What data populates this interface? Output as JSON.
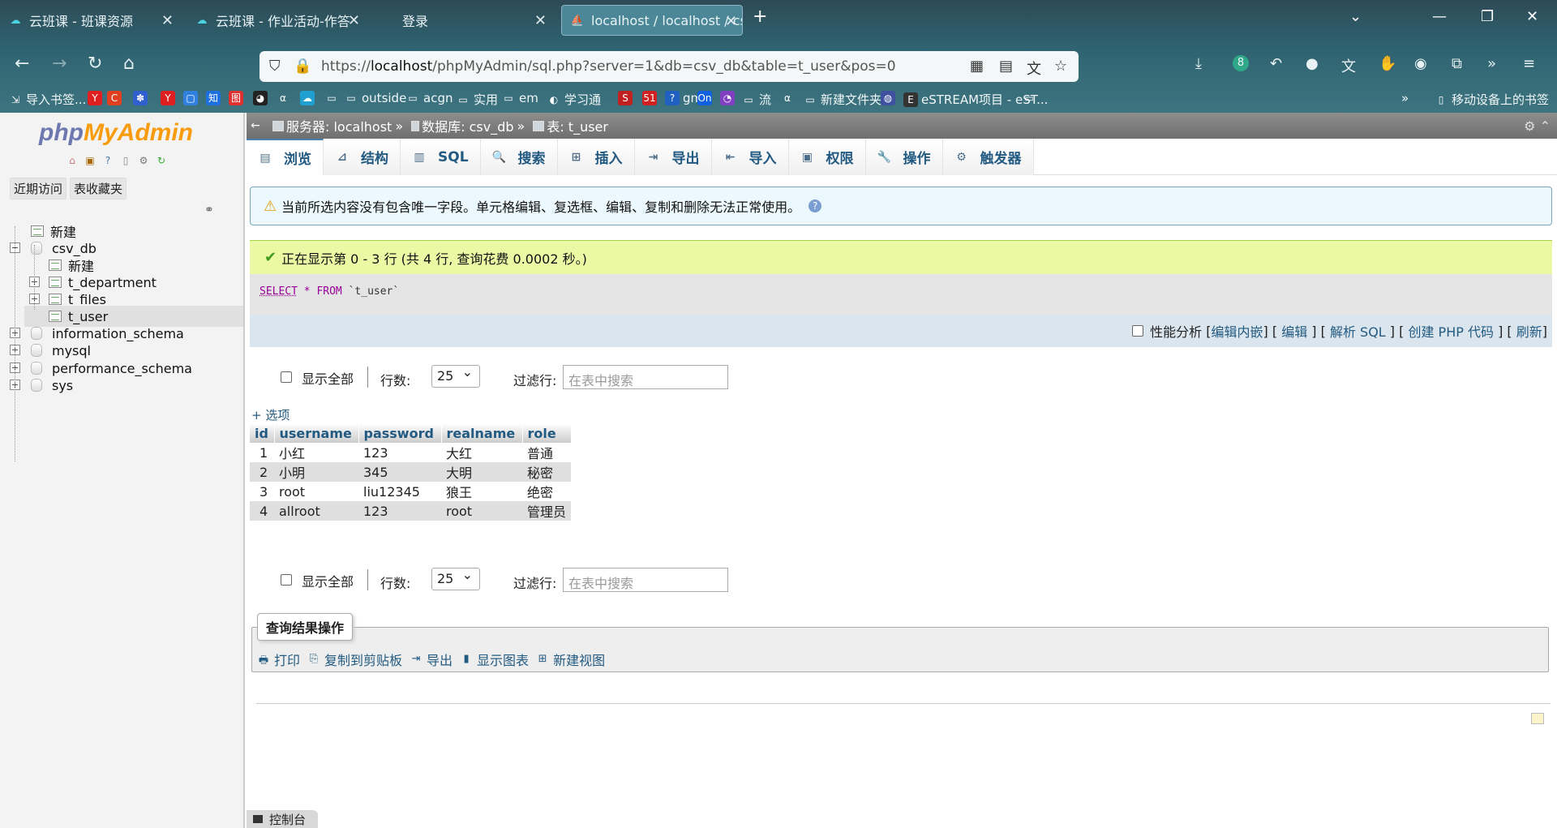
{
  "browser": {
    "tabs": [
      {
        "title": "云班课 - 班课资源",
        "icon": "cloud-class-icon",
        "active": false
      },
      {
        "title": "云班课 - 作业活动-作答",
        "icon": "cloud-class-icon",
        "active": false
      },
      {
        "title": "登录",
        "icon": "",
        "active": false
      },
      {
        "title": "localhost / localhost / csv_db",
        "icon": "pma-icon",
        "active": true
      }
    ],
    "new_tab": "+",
    "url_host": "localhost",
    "url_prefix": "https://",
    "url_path": "/phpMyAdmin/sql.php?server=1&db=csv_db&table=t_user&pos=0",
    "download_badge": "8",
    "bookmarks": [
      {
        "label": "导入书签...",
        "icon": "import-icon",
        "color": ""
      },
      {
        "label": "",
        "icon": "y-icon",
        "color": "#e02020"
      },
      {
        "label": "",
        "icon": "c-icon",
        "color": "#e04020"
      },
      {
        "label": "",
        "icon": "paw-icon",
        "color": "#3060d0"
      },
      {
        "label": "",
        "icon": "y2-icon",
        "color": "#e02020"
      },
      {
        "label": "",
        "icon": "blue-icon",
        "color": "#3080e0"
      },
      {
        "label": "",
        "icon": "zhi-icon",
        "color": "#1e6fe0"
      },
      {
        "label": "",
        "icon": "red-icon",
        "color": "#e03030"
      },
      {
        "label": "",
        "icon": "github-icon",
        "color": "#222"
      },
      {
        "label": "",
        "icon": "alpha-icon",
        "color": ""
      },
      {
        "label": "",
        "icon": "cloud-icon",
        "color": "#20a0d0"
      },
      {
        "label": "",
        "icon": "folder-icon",
        "color": ""
      },
      {
        "label": "outside",
        "icon": "folder-icon",
        "color": ""
      },
      {
        "label": "acgn",
        "icon": "folder-icon",
        "color": ""
      },
      {
        "label": "实用",
        "icon": "folder-icon",
        "color": ""
      },
      {
        "label": "em",
        "icon": "folder-icon",
        "color": ""
      },
      {
        "label": "学习通",
        "icon": "xxt-icon",
        "color": ""
      },
      {
        "label": "",
        "icon": "scihub-icon",
        "color": "#c02020"
      },
      {
        "label": "",
        "icon": "51-icon",
        "color": "#d02020"
      },
      {
        "label": "gmp",
        "icon": "help-icon",
        "color": "#2060c0"
      },
      {
        "label": "",
        "icon": "on-icon",
        "color": "#1060e0"
      },
      {
        "label": "",
        "icon": "chat-icon",
        "color": "#8040c0"
      },
      {
        "label": "流",
        "icon": "folder-icon",
        "color": ""
      },
      {
        "label": "",
        "icon": "alpha-icon",
        "color": ""
      },
      {
        "label": "新建文件夹",
        "icon": "folder-icon",
        "color": ""
      },
      {
        "label": "",
        "icon": "globe-icon",
        "color": "#4050a0"
      },
      {
        "label": "eSTREAM项目 - eST...",
        "icon": "ecr-icon",
        "color": "#333"
      },
      {
        "label": "",
        "icon": "folder-icon",
        "color": ""
      }
    ],
    "mobile_bookmarks": "移动设备上的书签"
  },
  "sidebar": {
    "logo_php": "php",
    "logo_admin": "MyAdmin",
    "tabs": [
      "近期访问",
      "表收藏夹"
    ],
    "tree": [
      {
        "label": "新建",
        "level": 0,
        "kind": "new"
      },
      {
        "label": "csv_db",
        "level": 0,
        "kind": "db",
        "expander": "−"
      },
      {
        "label": "新建",
        "level": 1,
        "kind": "new"
      },
      {
        "label": "t_department",
        "level": 1,
        "kind": "table",
        "expander": "+"
      },
      {
        "label": "t_files",
        "level": 1,
        "kind": "table",
        "expander": "+"
      },
      {
        "label": "t_user",
        "level": 1,
        "kind": "table",
        "expander": "+",
        "selected": true
      },
      {
        "label": "information_schema",
        "level": 0,
        "kind": "db",
        "expander": "+"
      },
      {
        "label": "mysql",
        "level": 0,
        "kind": "db",
        "expander": "+"
      },
      {
        "label": "performance_schema",
        "level": 0,
        "kind": "db",
        "expander": "+"
      },
      {
        "label": "sys",
        "level": 0,
        "kind": "db",
        "expander": "+"
      }
    ]
  },
  "breadcrumb": {
    "server": "服务器: localhost",
    "database": "数据库: csv_db",
    "table": "表: t_user",
    "sep": "»"
  },
  "tabs": [
    {
      "label": "浏览",
      "icon": "browse-icon",
      "glyph": "▤"
    },
    {
      "label": "结构",
      "icon": "structure-icon",
      "glyph": "⊿"
    },
    {
      "label": "SQL",
      "icon": "sql-icon",
      "glyph": "▥"
    },
    {
      "label": "搜索",
      "icon": "search-icon",
      "glyph": "🔍"
    },
    {
      "label": "插入",
      "icon": "insert-icon",
      "glyph": "⊞"
    },
    {
      "label": "导出",
      "icon": "export-icon",
      "glyph": "⇥"
    },
    {
      "label": "导入",
      "icon": "import-icon",
      "glyph": "⇤"
    },
    {
      "label": "权限",
      "icon": "privileges-icon",
      "glyph": "▣"
    },
    {
      "label": "操作",
      "icon": "operations-icon",
      "glyph": "🔧"
    },
    {
      "label": "触发器",
      "icon": "triggers-icon",
      "glyph": "⚙"
    }
  ],
  "notice": "当前所选内容没有包含唯一字段。单元格编辑、复选框、编辑、复制和删除无法正常使用。",
  "success": "正在显示第 0 - 3 行 (共 4 行, 查询花费 0.0002 秒。)",
  "sql": {
    "kw1": "SELECT",
    "op": "*",
    "kw2": "FROM",
    "name": "`t_user`"
  },
  "sql_tools": {
    "profiling": "性能分析",
    "inline_edit": "编辑内嵌",
    "edit": "编辑",
    "explain": "解析 SQL",
    "php_code": "创建 PHP 代码",
    "refresh": "刷新"
  },
  "nav": {
    "show_all": "显示全部",
    "rows_label": "行数:",
    "rows_value": "25",
    "filter_label": "过滤行:",
    "filter_placeholder": "在表中搜索"
  },
  "options_link": "+ 选项",
  "table": {
    "columns": [
      "id",
      "username",
      "password",
      "realname",
      "role"
    ],
    "rows": [
      [
        "1",
        "小红",
        "123",
        "大红",
        "普通"
      ],
      [
        "2",
        "小明",
        "345",
        "大明",
        "秘密"
      ],
      [
        "3",
        "root",
        "liu12345",
        "狼王",
        "绝密"
      ],
      [
        "4",
        "allroot",
        "123",
        "root",
        "管理员"
      ]
    ]
  },
  "query_ops": {
    "legend": "查询结果操作",
    "links": [
      {
        "label": "打印",
        "icon": "print-icon",
        "glyph": "🖶"
      },
      {
        "label": "复制到剪贴板",
        "icon": "clipboard-icon",
        "glyph": "⎘"
      },
      {
        "label": "导出",
        "icon": "export-icon",
        "glyph": "⇥"
      },
      {
        "label": "显示图表",
        "icon": "chart-icon",
        "glyph": "▮"
      },
      {
        "label": "新建视图",
        "icon": "view-icon",
        "glyph": "⊞"
      }
    ]
  },
  "console": "控制台"
}
